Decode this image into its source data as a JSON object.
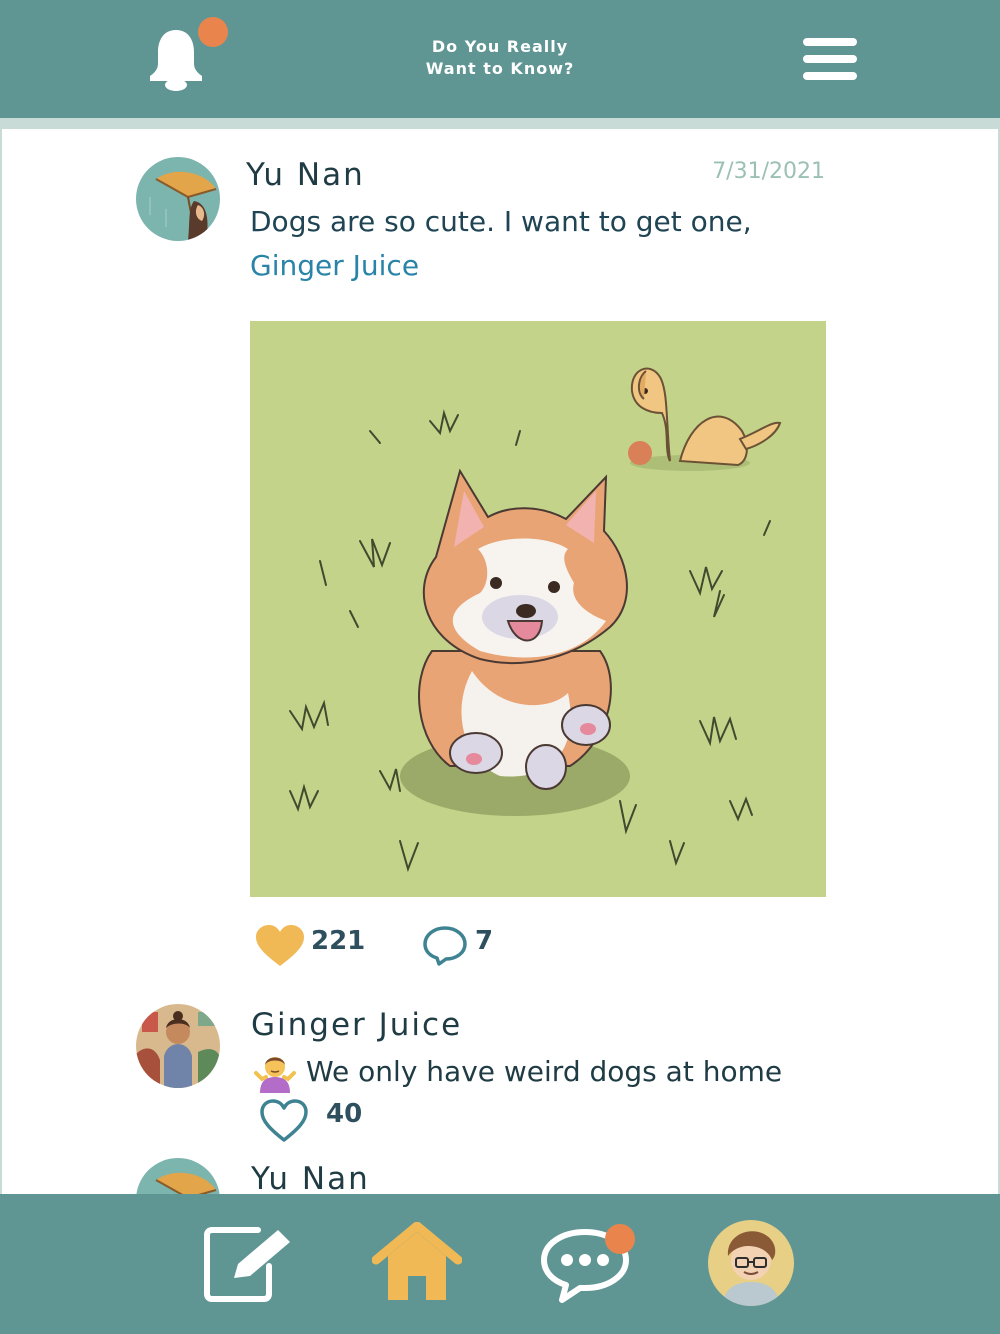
{
  "header": {
    "title_line1": "Do You Really",
    "title_line2": "Want to Know?",
    "bell_icon": "bell-icon",
    "has_notification": true,
    "menu_icon": "hamburger-menu-icon"
  },
  "post": {
    "author": "Yu Nan",
    "date": "7/31/2021",
    "text": "Dogs are so cute. I want to get one, ",
    "mention": "Ginger Juice",
    "image": "illustration of a corgi running on grass with a golden dog and ball behind",
    "like_count": "221",
    "comment_count": "7",
    "like_icon": "heart-filled-icon",
    "comment_icon": "speech-bubble-icon",
    "like_color": "#f0b955"
  },
  "comments": [
    {
      "author": "Ginger Juice",
      "emoji": "person-shrugging-emoji",
      "text": "We only have weird dogs at home",
      "like_count": "40",
      "like_icon": "heart-outline-icon"
    },
    {
      "author": "Yu Nan"
    }
  ],
  "bottom_nav": {
    "items": [
      "compose-icon",
      "home-icon",
      "chat-icon",
      "profile-avatar"
    ],
    "active": "home-icon",
    "chat_has_notification": true
  },
  "colors": {
    "bar": "#5f9694",
    "accent": "#f0b955",
    "notification": "#e9854c",
    "mention": "#2a84a8"
  }
}
